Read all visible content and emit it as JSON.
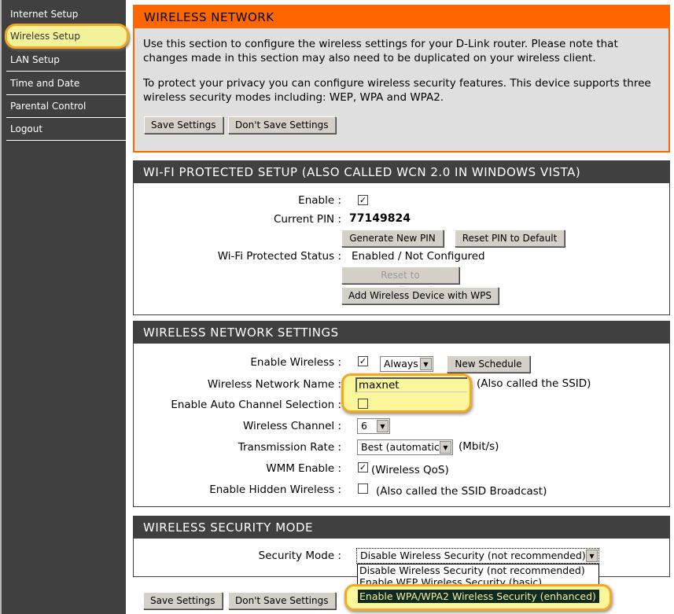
{
  "sidebar": {
    "items": [
      {
        "label": "Internet Setup"
      },
      {
        "label": "Wireless Setup",
        "active": true
      },
      {
        "label": "LAN Setup"
      },
      {
        "label": "Time and Date"
      },
      {
        "label": "Parental Control"
      },
      {
        "label": "Logout"
      }
    ]
  },
  "wireless_network": {
    "title": "WIRELESS NETWORK",
    "para1": "Use this section to configure the wireless settings for your D-Link router. Please note that changes made in this section may also need to be duplicated on your wireless client.",
    "para2": "To protect your privacy you can configure wireless security features. This device supports three wireless security modes including: WEP, WPA and WPA2.",
    "save": "Save Settings",
    "dont_save": "Don't Save Settings"
  },
  "wps": {
    "title": "WI-FI PROTECTED SETUP (ALSO CALLED WCN 2.0 IN WINDOWS VISTA)",
    "enable_label": "Enable :",
    "enable_checked": true,
    "pin_label": "Current PIN :",
    "pin": "77149824",
    "gen_pin": "Generate New PIN",
    "reset_pin": "Reset PIN to Default",
    "status_label": "Wi-Fi Protected Status :",
    "status": "Enabled / Not Configured",
    "reset_unconf": "Reset to Unconfigured",
    "add_device": "Add Wireless Device with WPS"
  },
  "wns": {
    "title": "WIRELESS NETWORK SETTINGS",
    "enable_label": "Enable Wireless :",
    "enable_checked": true,
    "schedule": "Always",
    "new_schedule": "New Schedule",
    "name_label": "Wireless Network Name :",
    "name": "maxnet",
    "name_note": "(Also called the SSID)",
    "auto_label": "Enable Auto Channel Selection :",
    "auto_checked": false,
    "channel_label": "Wireless Channel :",
    "channel": "6",
    "rate_label": "Transmission Rate :",
    "rate": "Best (automatic)",
    "rate_unit": "(Mbit/s)",
    "wmm_label": "WMM Enable :",
    "wmm_checked": true,
    "wmm_note": "(Wireless QoS)",
    "hidden_label": "Enable Hidden Wireless :",
    "hidden_checked": false,
    "hidden_note": "(Also called the SSID Broadcast)"
  },
  "security": {
    "title": "WIRELESS SECURITY MODE",
    "mode_label": "Security Mode :",
    "mode": "Disable Wireless Security (not recommended)",
    "options": [
      "Disable Wireless Security (not recommended)",
      "Enable WEP Wireless Security (basic)",
      "Enable WPA/WPA2 Wireless Security (enhanced)"
    ]
  },
  "footer": {
    "save": "Save Settings",
    "dont_save": "Don't Save Settings"
  },
  "colors": {
    "accent": "#ff6600",
    "header": "#404040",
    "highlight": "#f5a623"
  }
}
